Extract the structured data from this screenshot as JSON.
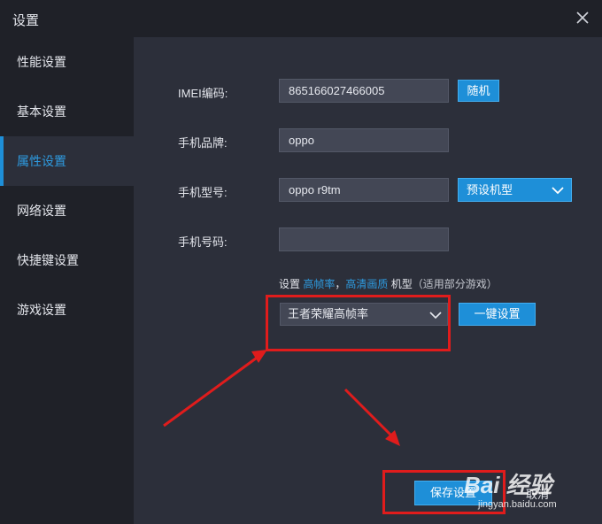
{
  "window": {
    "title": "设置"
  },
  "sidebar": {
    "items": [
      {
        "label": "性能设置"
      },
      {
        "label": "基本设置"
      },
      {
        "label": "属性设置",
        "active": true
      },
      {
        "label": "网络设置"
      },
      {
        "label": "快捷键设置"
      },
      {
        "label": "游戏设置"
      }
    ]
  },
  "form": {
    "imei_label": "IMEI编码:",
    "imei_value": "865166027466005",
    "random_label": "随机",
    "brand_label": "手机品牌:",
    "brand_value": "oppo",
    "model_label": "手机型号:",
    "model_value": "oppo r9tm",
    "preset_select": "预设机型",
    "phone_label": "手机号码:",
    "phone_value": "",
    "note_prefix": "设置 ",
    "note_link1": "高帧率",
    "note_sep": "，",
    "note_link2": "高清画质",
    "note_mid": " 机型",
    "note_suffix": "（适用部分游戏）",
    "game_select": "王者荣耀高帧率",
    "one_click_label": "一键设置"
  },
  "footer": {
    "save_label": "保存设置",
    "cancel_label": "取消"
  },
  "watermark": {
    "logo": "Bai 经验",
    "url": "jingyan.baidu.com"
  },
  "colors": {
    "accent": "#1e8fd8",
    "panel": "#2c2f3a",
    "sidebar": "#1f2128",
    "annotation_red": "#e01c1c"
  },
  "icons": [
    "close-icon",
    "chevron-down-icon",
    "arrow-annotation",
    "paw-logo-icon"
  ]
}
